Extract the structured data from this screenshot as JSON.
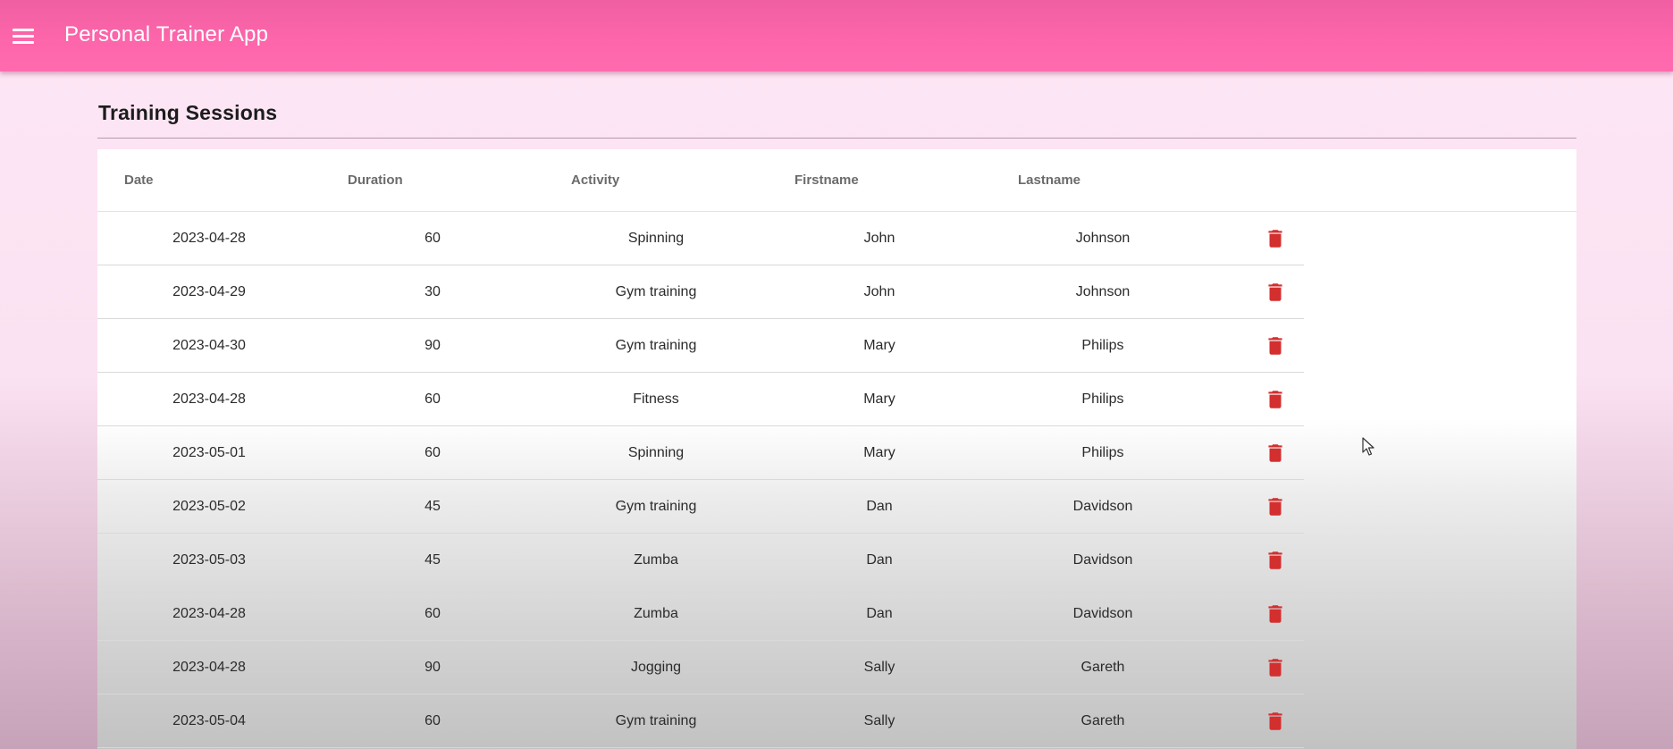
{
  "app": {
    "title": "Personal Trainer App"
  },
  "page": {
    "title": "Training Sessions"
  },
  "table": {
    "columns": [
      "Date",
      "Duration",
      "Activity",
      "Firstname",
      "Lastname"
    ],
    "rows": [
      {
        "date": "2023-04-28",
        "duration": "60",
        "activity": "Spinning",
        "firstname": "John",
        "lastname": "Johnson"
      },
      {
        "date": "2023-04-29",
        "duration": "30",
        "activity": "Gym training",
        "firstname": "John",
        "lastname": "Johnson"
      },
      {
        "date": "2023-04-30",
        "duration": "90",
        "activity": "Gym training",
        "firstname": "Mary",
        "lastname": "Philips"
      },
      {
        "date": "2023-04-28",
        "duration": "60",
        "activity": "Fitness",
        "firstname": "Mary",
        "lastname": "Philips"
      },
      {
        "date": "2023-05-01",
        "duration": "60",
        "activity": "Spinning",
        "firstname": "Mary",
        "lastname": "Philips"
      },
      {
        "date": "2023-05-02",
        "duration": "45",
        "activity": "Gym training",
        "firstname": "Dan",
        "lastname": "Davidson"
      },
      {
        "date": "2023-05-03",
        "duration": "45",
        "activity": "Zumba",
        "firstname": "Dan",
        "lastname": "Davidson"
      },
      {
        "date": "2023-04-28",
        "duration": "60",
        "activity": "Zumba",
        "firstname": "Dan",
        "lastname": "Davidson"
      },
      {
        "date": "2023-04-28",
        "duration": "90",
        "activity": "Jogging",
        "firstname": "Sally",
        "lastname": "Gareth"
      },
      {
        "date": "2023-05-04",
        "duration": "60",
        "activity": "Gym training",
        "firstname": "Sally",
        "lastname": "Gareth"
      }
    ],
    "delete_icon": "trash-icon"
  },
  "colors": {
    "appbar": "#ff66ab",
    "delete": "#d32f2f",
    "page_background": "#fde6f5"
  }
}
